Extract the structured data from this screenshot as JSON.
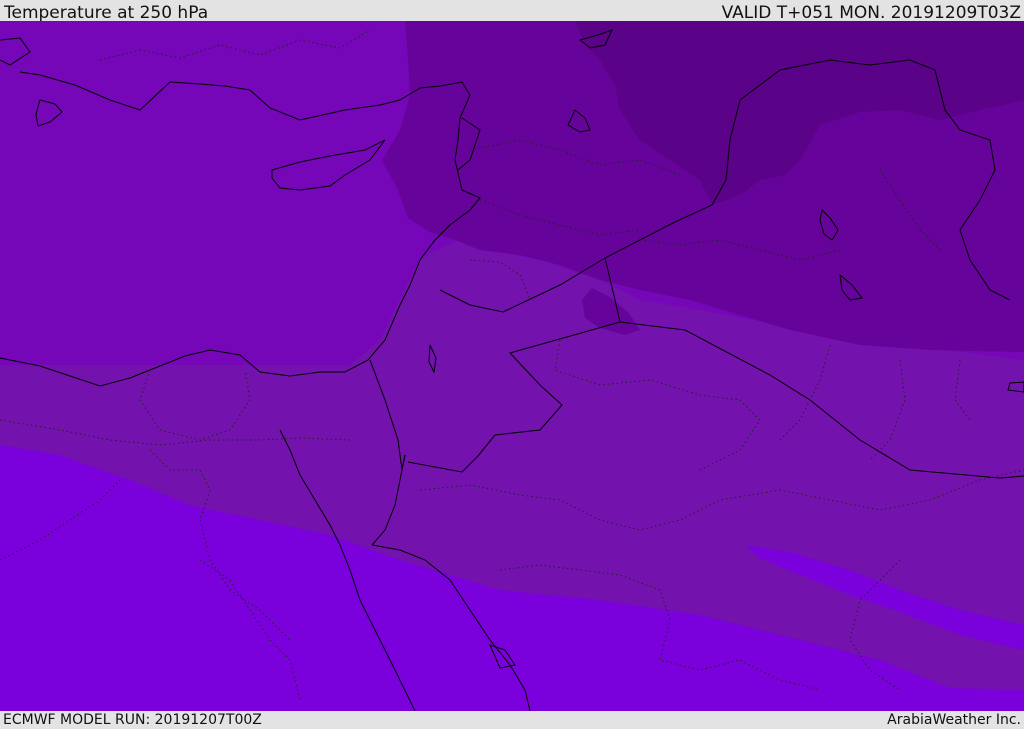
{
  "header": {
    "title": "Temperature at 250 hPa",
    "valid_time": "VALID T+051 MON. 20191209T03Z"
  },
  "footer": {
    "model_run": "ECMWF MODEL RUN: 20191207T00Z",
    "credit": "ArabiaWeather Inc."
  },
  "colors": {
    "band_coldest": "#5a0288",
    "band_colder": "#66039a",
    "band_mid": "#7412ad",
    "band_warm": "#7507b8",
    "band_warmest": "#7a00dc",
    "lines": "#000000",
    "frame": "#e3e3e3"
  }
}
